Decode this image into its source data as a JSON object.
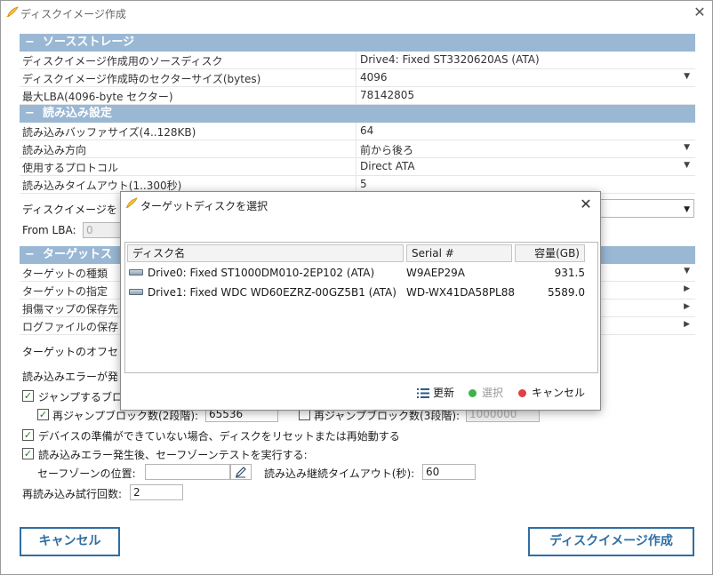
{
  "window": {
    "title": "ディスクイメージ作成",
    "close": "✕"
  },
  "sections": {
    "source": {
      "header": "ソースストレージ",
      "rows": [
        {
          "k": "ディスクイメージ作成用のソースディスク",
          "v": "Drive4: Fixed ST3320620AS (ATA)"
        },
        {
          "k": "ディスクイメージ作成時のセクターサイズ(bytes)",
          "v": "4096"
        },
        {
          "k": "最大LBA(4096-byte セクター)",
          "v": "78142805"
        }
      ]
    },
    "read": {
      "header": "読み込み設定",
      "rows": [
        {
          "k": "読み込みバッファサイズ(4..128KB)",
          "v": "64"
        },
        {
          "k": "読み込み方向",
          "v": "前から後ろ"
        },
        {
          "k": "使用するプロトコル",
          "v": "Direct ATA"
        },
        {
          "k": "読み込みタイムアウト(1..300秒)",
          "v": "5"
        }
      ]
    },
    "target": {
      "header": "ターゲットス",
      "rows": [
        {
          "k": "ターゲットの種類"
        },
        {
          "k": "ターゲットの指定"
        },
        {
          "k": "損傷マップの保存先"
        },
        {
          "k": "ログファイルの保存"
        }
      ]
    }
  },
  "misc": {
    "image_label": "ディスクイメージを",
    "from_lba_label": "From LBA:",
    "from_lba_value": "0",
    "offset_label": "ターゲットのオフセ",
    "read_error_label": "読み込みエラーが発",
    "jump_label": "ジャンプするブロ",
    "rejump2_label": "再ジャンプブロック数(2段階):",
    "rejump2_value": "65536",
    "rejump3_label": "再ジャンプブロック数(3段階):",
    "rejump3_value": "1000000",
    "reset_label": "デバイスの準備ができていない場合、ディスクをリセットまたは再始動する",
    "safezone_label": "読み込みエラー発生後、セーフゾーンテストを実行する:",
    "safezone_pos_label": "セーフゾーンの位置:",
    "safezone_pos_value": "",
    "continue_timeout_label": "読み込み継続タイムアウト(秒):",
    "continue_timeout_value": "60",
    "retry_label": "再読み込み試行回数:",
    "retry_value": "2"
  },
  "buttons": {
    "cancel": "キャンセル",
    "create": "ディスクイメージ作成"
  },
  "modal": {
    "title": "ターゲットディスクを選択",
    "columns": [
      "ディスク名",
      "Serial #",
      "容量(GB)"
    ],
    "rows": [
      {
        "name": "Drive0: Fixed ST1000DM010-2EP102 (ATA)",
        "serial": "W9AEP29A",
        "size": "931.5"
      },
      {
        "name": "Drive1: Fixed WDC WD60EZRZ-00GZ5B1 (ATA)",
        "serial": "WD-WX41DA58PL88",
        "size": "5589.0"
      }
    ],
    "refresh": "更新",
    "select": "選択",
    "cancel": "キャンセル"
  },
  "colors": {
    "section_bg": "#9ab8d4",
    "accent": "#2f6ea3",
    "select_dot": "#3cb44b",
    "cancel_dot": "#e04040"
  },
  "dropdown_glyph": "▼",
  "arrow_glyph": "▶",
  "minus_glyph": "−"
}
